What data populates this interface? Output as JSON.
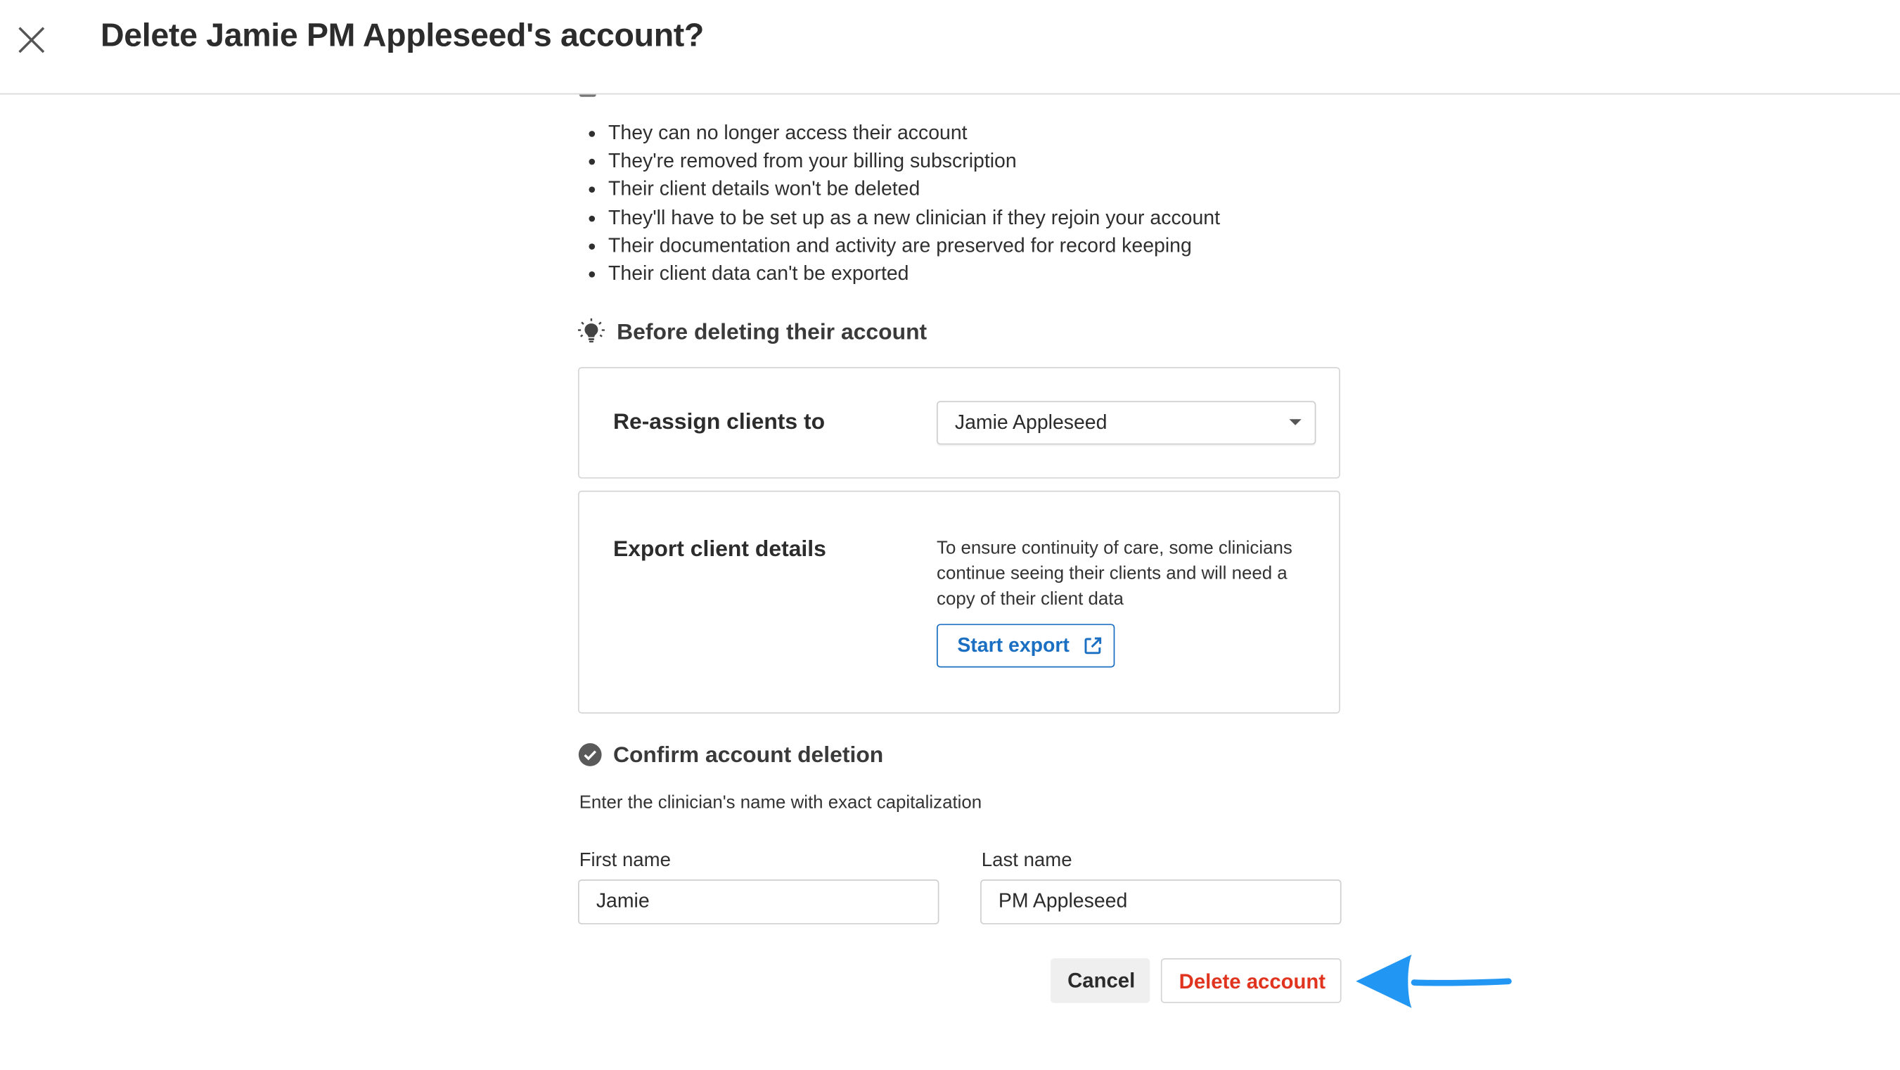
{
  "header": {
    "title": "Delete Jamie PM Appleseed's account?"
  },
  "consequences": [
    "They can no longer access their account",
    "They're removed from your billing subscription",
    "Their client details won't be deleted",
    "They'll have to be set up as a new clinician if they rejoin your account",
    "Their documentation and activity are preserved for record keeping",
    "Their client data can't be exported"
  ],
  "before_section": {
    "heading": "Before deleting their account",
    "icon": "lightbulb-icon"
  },
  "reassign": {
    "label": "Re-assign clients to",
    "selected": "Jamie Appleseed"
  },
  "export": {
    "label": "Export client details",
    "description": "To ensure continuity of care, some clinicians continue seeing their clients and will need a copy of their client data",
    "button_label": "Start export",
    "accent_color": "#1b6fc2"
  },
  "confirm_section": {
    "heading": "Confirm account deletion",
    "icon": "check-circle-icon",
    "instructions": "Enter the clinician's name with exact capitalization",
    "first_name_label": "First name",
    "first_name_value": "Jamie",
    "last_name_label": "Last name",
    "last_name_value": "PM Appleseed"
  },
  "actions": {
    "cancel_label": "Cancel",
    "delete_label": "Delete account",
    "danger_color": "#e0341f",
    "annotation_color": "#2196f3"
  }
}
